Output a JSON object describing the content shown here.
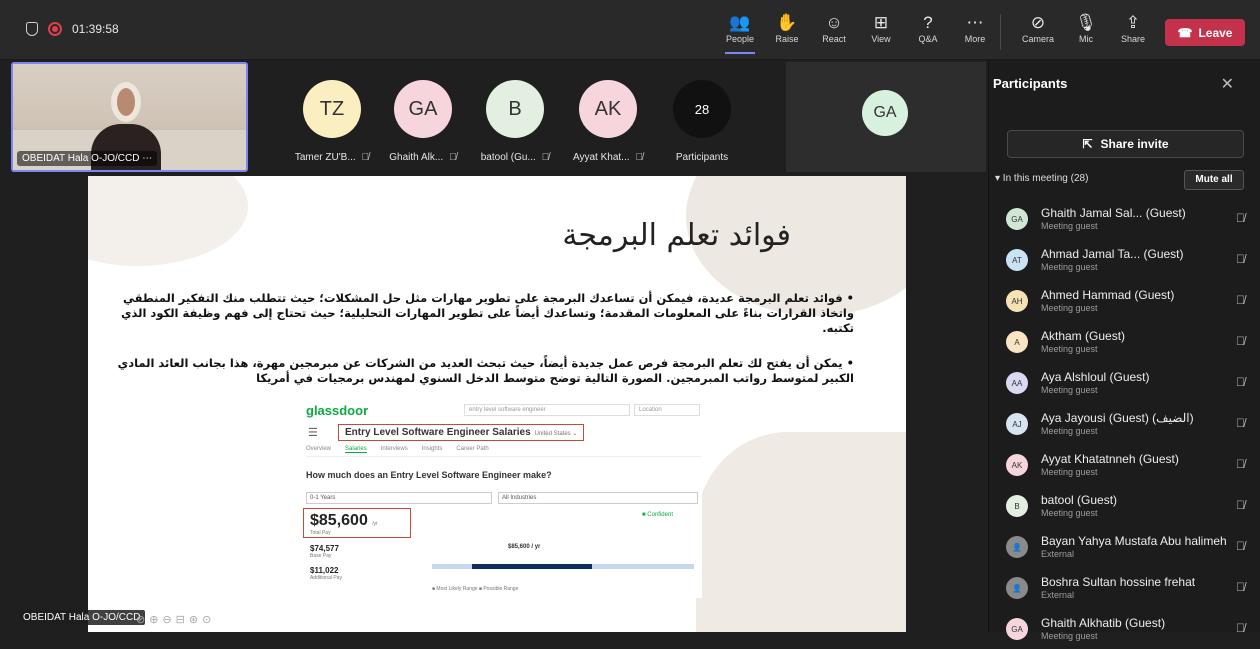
{
  "topbar": {
    "recording_time": "01:39:58",
    "buttons": [
      {
        "label": "People",
        "icon": "people-icon",
        "glyph": "👥"
      },
      {
        "label": "Raise",
        "icon": "raise-hand-icon",
        "glyph": "✋"
      },
      {
        "label": "React",
        "icon": "react-icon",
        "glyph": "☺"
      },
      {
        "label": "View",
        "icon": "view-icon",
        "glyph": "⊞"
      },
      {
        "label": "Q&A",
        "icon": "qa-icon",
        "glyph": "?"
      },
      {
        "label": "More",
        "icon": "more-icon",
        "glyph": "⋯"
      },
      {
        "label": "Camera",
        "icon": "camera-off-icon",
        "glyph": "⊘"
      },
      {
        "label": "Mic",
        "icon": "mic-off-icon",
        "glyph": "🎙"
      },
      {
        "label": "Share",
        "icon": "share-icon",
        "glyph": "⇪"
      }
    ],
    "leave_label": "Leave"
  },
  "self_video": {
    "name": "OBEIDAT Hala O-JO/CCD",
    "more": "⋯"
  },
  "tiles": [
    {
      "initials": "TZ",
      "name": "Tamer ZU'B...",
      "color": "#fbefc2"
    },
    {
      "initials": "GA",
      "name": "Ghaith Alk...",
      "color": "#f6d6dc"
    },
    {
      "initials": "B",
      "name": "batool (Gu...",
      "color": "#e3efe0"
    },
    {
      "initials": "AK",
      "name": "Ayyat Khat...",
      "color": "#f6d6dc"
    }
  ],
  "overflow_tile": {
    "count": "28",
    "label": "Participants"
  },
  "ga_tile": {
    "initials": "GA"
  },
  "slide": {
    "title": "فوائد تعلم البرمجة",
    "bullet1": "فوائد تعلم البرمجة عديدة، فيمكن أن تساعدك البرمجة على تطوير مهارات مثل حل المشكلات؛ حيث تتطلب منك التفكير المنطقي واتخاذ القرارات بناءً على المعلومات المقدمة؛ وتساعدك أيضاً على تطوير المهارات التحليلية؛ حيث تحتاج إلى فهم وظيفة الكود الذي تكتبه.",
    "bullet2": "يمكن أن يفتح لك تعلم البرمجة فرص عمل جديدة أيضاً، حيث تبحث العديد من الشركات عن مبرمجين مهرة، هذا بجانب العائد المادي الكبير لمتوسط رواتب المبرمجين. الصورة التالية توضح متوسط الدخل السنوي لمهندس برمجيات في أمريكا",
    "glassdoor": {
      "logo": "glassdoor",
      "search": "entry level software engineer",
      "location": "Location",
      "header": "Entry Level Software Engineer Salaries",
      "country": "United States ⌄",
      "tabs": [
        "Overview",
        "Salaries",
        "Interviews",
        "Insights",
        "Career Path"
      ],
      "question": "How much does an Entry Level Software Engineer make?",
      "experience": "0-1 Years",
      "industry": "All Industries",
      "total_pay": "$85,600",
      "total_pay_unit": "/yr",
      "total_pay_label": "Total Pay",
      "confident": "Confident",
      "base_pay": "$74,577",
      "base_pay_label": "Base Pay",
      "additional_pay": "$11,022",
      "additional_pay_label": "Additional Pay",
      "mid_value": "$85,600 / yr",
      "legend": "■ Most Likely Range   ■ Possible Range"
    }
  },
  "bottom_label": "OBEIDAT Hala O-JO/CCD",
  "panel": {
    "title": "Participants",
    "share_invite": "Share invite",
    "in_meeting": "▾ In this meeting (28)",
    "mute_all": "Mute all",
    "participants": [
      {
        "initials": "GA",
        "name": "Ghaith Jamal Sal... (Guest)",
        "role": "Meeting guest",
        "color": "#cfe8d6"
      },
      {
        "initials": "AT",
        "name": "Ahmad Jamal Ta... (Guest)",
        "role": "Meeting guest",
        "color": "#c9e2f5"
      },
      {
        "initials": "AH",
        "name": "Ahmed Hammad (Guest)",
        "role": "Meeting guest",
        "color": "#f6e2b5"
      },
      {
        "initials": "A",
        "name": "Aktham (Guest)",
        "role": "Meeting guest",
        "color": "#f9e4c6"
      },
      {
        "initials": "AA",
        "name": "Aya Alshloul (Guest)",
        "role": "Meeting guest",
        "color": "#d9d9f2"
      },
      {
        "initials": "AJ",
        "name": "Aya Jayousi (Guest) (الضيف)",
        "role": "Meeting guest",
        "color": "#d8e4ef"
      },
      {
        "initials": "AK",
        "name": "Ayyat Khatatnneh (Guest)",
        "role": "Meeting guest",
        "color": "#f6d6dc"
      },
      {
        "initials": "B",
        "name": "batool (Guest)",
        "role": "Meeting guest",
        "color": "#e3efe0"
      },
      {
        "initials": "👤",
        "name": "Bayan Yahya Mustafa Abu halimeh",
        "role": "External",
        "color": "#8a8a8a"
      },
      {
        "initials": "👤",
        "name": "Boshra Sultan hossine frehat",
        "role": "External",
        "color": "#8a8a8a"
      },
      {
        "initials": "GA",
        "name": "Ghaith Alkhatib (Guest)",
        "role": "Meeting guest",
        "color": "#f6d6dc"
      }
    ]
  }
}
